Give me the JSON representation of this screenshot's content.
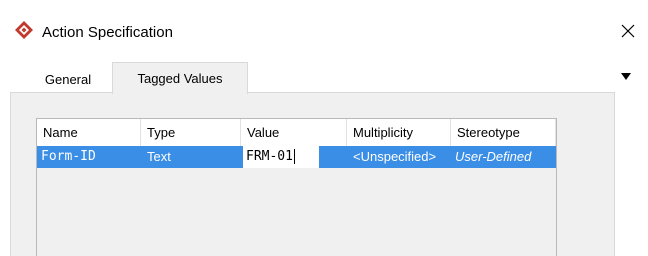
{
  "window": {
    "title": "Action Specification",
    "close_icon": "close-icon",
    "app_icon": "diamond-logo-icon",
    "accent_color": "#c0392b"
  },
  "tabs": [
    {
      "label": "General",
      "selected": false
    },
    {
      "label": "Tagged Values",
      "selected": true
    }
  ],
  "overflow_icon": "triangle-down-icon",
  "table": {
    "columns": [
      "Name",
      "Type",
      "Value",
      "Multiplicity",
      "Stereotype"
    ],
    "rows": [
      {
        "name": "Form-ID",
        "type": "Text",
        "value": "FRM-01",
        "multiplicity": "<Unspecified>",
        "stereotype": "User-Defined",
        "selected": true
      }
    ],
    "selection_color": "#3a8ee6"
  }
}
